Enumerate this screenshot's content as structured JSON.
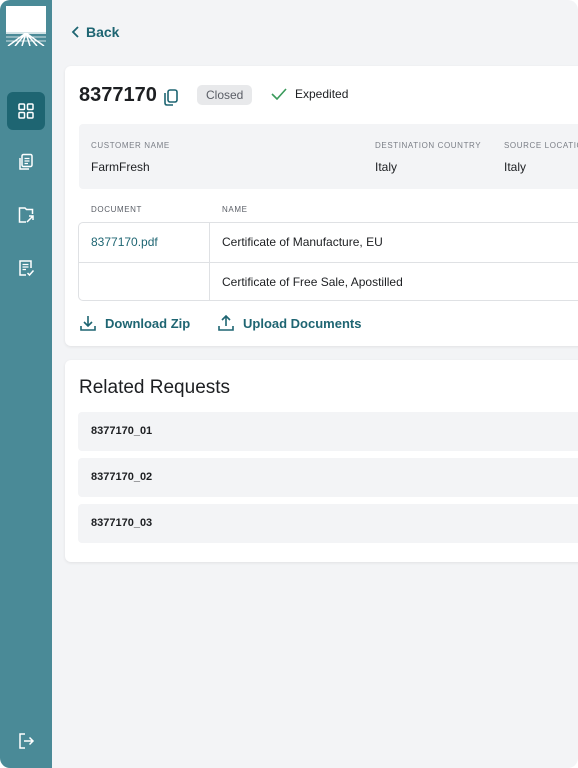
{
  "sidebar": {
    "items": [
      {
        "name": "dashboard",
        "active": true
      },
      {
        "name": "documents",
        "active": false
      },
      {
        "name": "upload",
        "active": false
      },
      {
        "name": "checklist",
        "active": false
      }
    ],
    "logout": "logout-icon"
  },
  "header": {
    "back_label": "Back"
  },
  "request": {
    "id": "8377170",
    "status": "Closed",
    "expedited_label": "Expedited",
    "fields": [
      {
        "label": "CUSTOMER NAME",
        "value": "FarmFresh"
      },
      {
        "label": "DESTINATION COUNTRY",
        "value": "Italy"
      },
      {
        "label": "SOURCE LOCATIO",
        "value": "Italy"
      }
    ],
    "documents_table": {
      "columns": [
        "DOCUMENT",
        "NAME"
      ],
      "rows": [
        {
          "document": "8377170.pdf",
          "name": "Certificate of Manufacture, EU"
        },
        {
          "document": "",
          "name": "Certificate of Free Sale, Apostilled"
        }
      ]
    },
    "actions": {
      "download_label": "Download Zip",
      "upload_label": "Upload Documents"
    }
  },
  "related": {
    "title": "Related Requests",
    "items": [
      "8377170_01",
      "8377170_02",
      "8377170_03"
    ]
  },
  "colors": {
    "sidebar": "#4a8a97",
    "sidebar_active": "#1e6572",
    "accent": "#1e6572",
    "check": "#3a9a5b",
    "background": "#f3f4f6"
  }
}
